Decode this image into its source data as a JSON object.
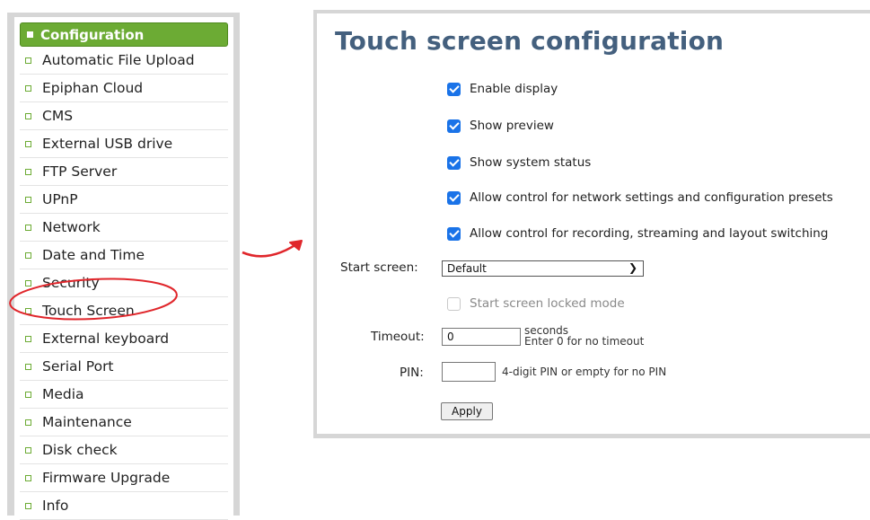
{
  "sidebar": {
    "header": "Configuration",
    "items": [
      {
        "label": "Automatic File Upload"
      },
      {
        "label": "Epiphan Cloud"
      },
      {
        "label": "CMS"
      },
      {
        "label": "External USB drive"
      },
      {
        "label": "FTP Server"
      },
      {
        "label": "UPnP"
      },
      {
        "label": "Network"
      },
      {
        "label": "Date and Time"
      },
      {
        "label": "Security"
      },
      {
        "label": "Touch Screen"
      },
      {
        "label": "External keyboard"
      },
      {
        "label": "Serial Port"
      },
      {
        "label": "Media"
      },
      {
        "label": "Maintenance"
      },
      {
        "label": "Disk check"
      },
      {
        "label": "Firmware Upgrade"
      },
      {
        "label": "Info"
      }
    ]
  },
  "main": {
    "title": "Touch screen configuration",
    "checkboxes": [
      {
        "label": "Enable display",
        "checked": true
      },
      {
        "label": "Show preview",
        "checked": true
      },
      {
        "label": "Show system status",
        "checked": true
      },
      {
        "label": "Allow control for network settings and configuration presets",
        "checked": true
      },
      {
        "label": "Allow control for recording, streaming and layout switching",
        "checked": true
      }
    ],
    "start_screen": {
      "label": "Start screen:",
      "value": "Default"
    },
    "locked_mode": {
      "label": "Start screen locked mode",
      "checked": false,
      "disabled": true
    },
    "timeout": {
      "label": "Timeout:",
      "value": "0",
      "unit": "seconds",
      "hint": "Enter 0 for no timeout"
    },
    "pin": {
      "label": "PIN:",
      "value": "",
      "hint": "4-digit PIN or empty for no PIN"
    },
    "apply_label": "Apply"
  },
  "annotation": {
    "highlight_color": "#e0262b"
  }
}
